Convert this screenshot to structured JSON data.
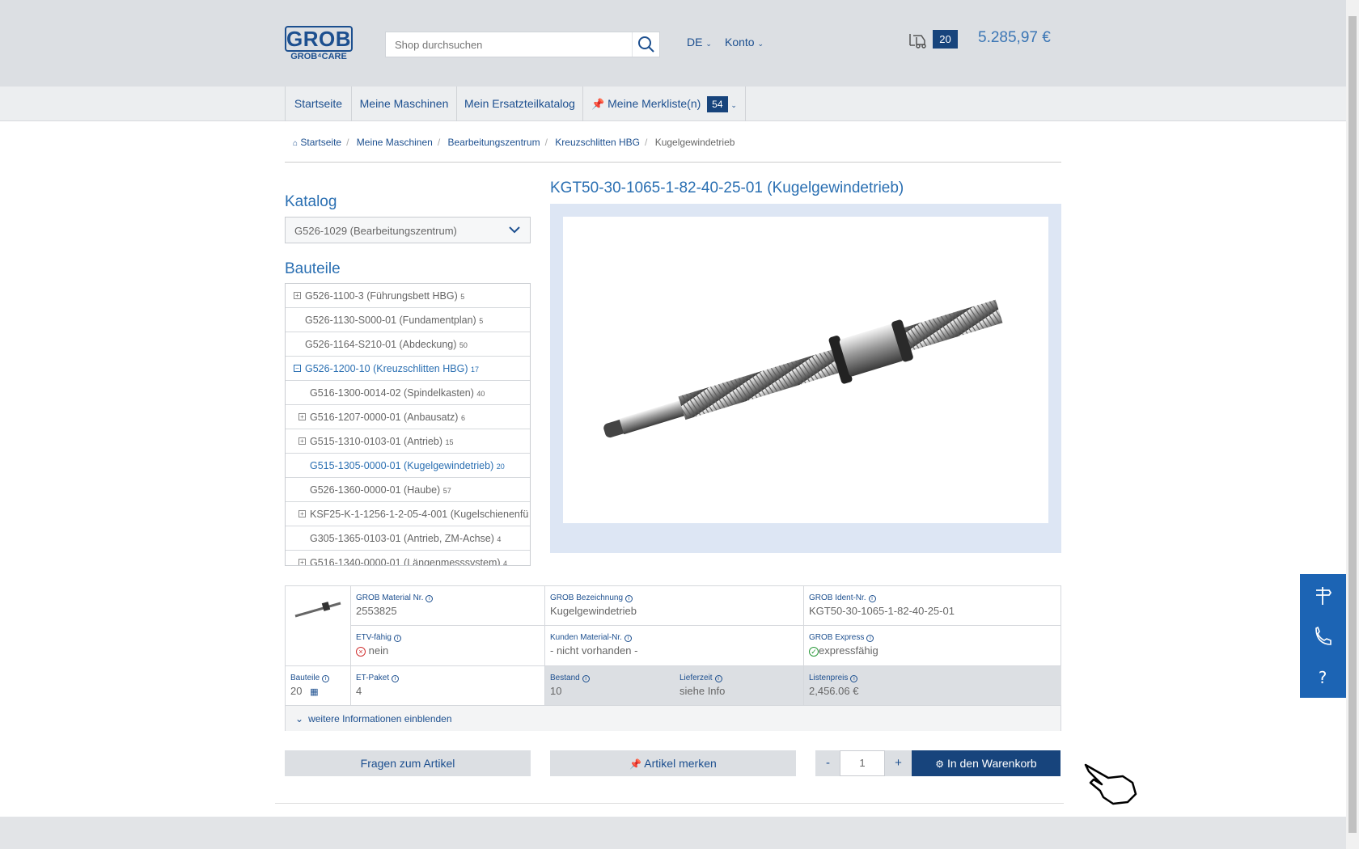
{
  "header": {
    "logo_main": "GROB",
    "logo_sub": "GROB⁴CARE",
    "search_placeholder": "Shop durchsuchen",
    "language": "DE",
    "account": "Konto",
    "cart_count": "20",
    "cart_total": "5.285,97 €"
  },
  "nav": {
    "items": [
      "Startseite",
      "Meine Maschinen",
      "Mein Ersatzteilkatalog",
      "Meine Merkliste(n)"
    ],
    "wishlist_count": "54"
  },
  "breadcrumb": [
    "Startseite",
    "Meine Maschinen",
    "Bearbeitungszentrum",
    "Kreuzschlitten HBG",
    "Kugelgewindetrieb"
  ],
  "catalog": {
    "title": "Katalog",
    "selected": "G526-1029 (Bearbeitungszentrum)"
  },
  "parts": {
    "title": "Bauteile",
    "rows": [
      {
        "label": "G526-1100-3 (Führungsbett HBG)",
        "count": "5"
      },
      {
        "label": "G526-1130-S000-01 (Fundamentplan)",
        "count": "5"
      },
      {
        "label": "G526-1164-S210-01 (Abdeckung)",
        "count": "50"
      },
      {
        "label": "G526-1200-10 (Kreuzschlitten HBG)",
        "count": "17"
      },
      {
        "label": "G516-1300-0014-02 (Spindelkasten)",
        "count": "40"
      },
      {
        "label": "G516-1207-0000-01 (Anbausatz)",
        "count": "6"
      },
      {
        "label": "G515-1310-0103-01 (Antrieb)",
        "count": "15"
      },
      {
        "label": "G515-1305-0000-01 (Kugelgewindetrieb)",
        "count": "20"
      },
      {
        "label": "G526-1360-0000-01 (Haube)",
        "count": "57"
      },
      {
        "label": "KSF25-K-1-1256-1-2-05-4-001 (Kugelschienenfü",
        "count": ""
      },
      {
        "label": "G305-1365-0103-01 (Antrieb, ZM-Achse)",
        "count": "4"
      },
      {
        "label": "G516-1340-0000-01 (Längenmesssystem)",
        "count": "4"
      }
    ]
  },
  "product": {
    "title": "KGT50-30-1065-1-82-40-25-01 (Kugelgewindetrieb)",
    "material_nr_label": "GROB Material Nr.",
    "material_nr": "2553825",
    "bezeichnung_label": "GROB Bezeichnung",
    "bezeichnung": "Kugelgewindetrieb",
    "ident_label": "GROB Ident-Nr.",
    "ident": "KGT50-30-1065-1-82-40-25-01",
    "etv_label": "ETV-fähig",
    "etv": "nein",
    "kunden_label": "Kunden Material-Nr.",
    "kunden": "- nicht vorhanden -",
    "express_label": "GROB Express",
    "express": "expressfähig",
    "bauteile_label": "Bauteile",
    "bauteile": "20",
    "etpaket_label": "ET-Paket",
    "etpaket": "4",
    "bestand_label": "Bestand",
    "bestand": "10",
    "lieferzeit_label": "Lieferzeit",
    "lieferzeit": "siehe Info",
    "listenpreis_label": "Listenpreis",
    "listenpreis": "2,456.06 €",
    "more_info": "weitere Informationen einblenden"
  },
  "actions": {
    "ask": "Fragen zum Artikel",
    "remember": "Artikel merken",
    "minus": "-",
    "qty": "1",
    "plus": "+",
    "add_to_cart": "In den Warenkorb"
  },
  "colors": {
    "primary": "#1c4f8f",
    "accent": "#2a6fb2",
    "header_bg": "#dcdfe3",
    "side_panel": "#1c64b4"
  }
}
